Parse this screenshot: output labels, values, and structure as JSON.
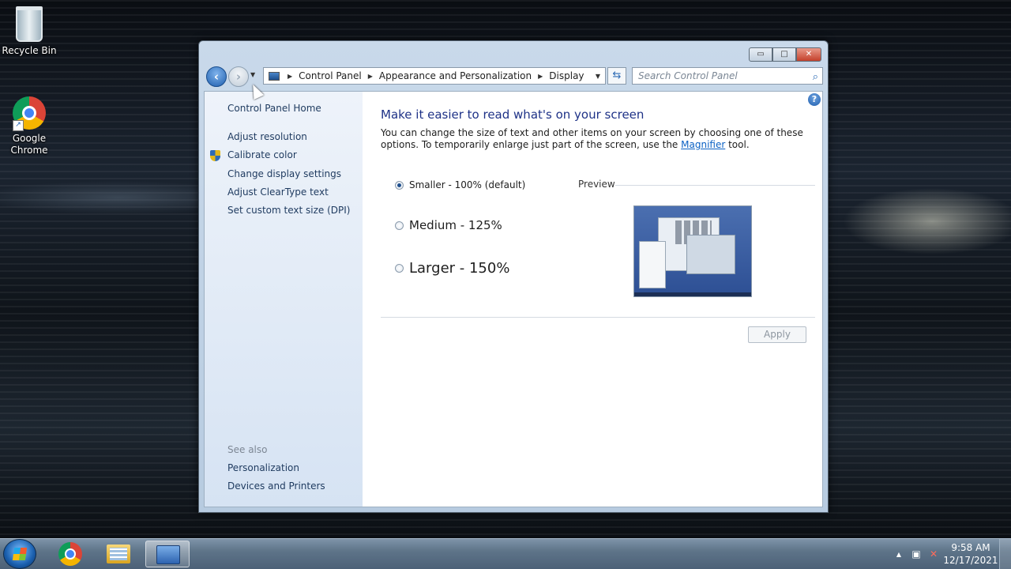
{
  "desktop": {
    "icons": [
      {
        "label": "Recycle Bin"
      },
      {
        "label": "Google\nChrome"
      }
    ]
  },
  "window": {
    "controls": {
      "minimize": "▭",
      "maximize": "□",
      "close": "✕"
    },
    "nav": {
      "back": "‹",
      "forward": "›",
      "dropdown": "▼"
    },
    "address": {
      "crumbs": [
        "Control Panel",
        "Appearance and Personalization",
        "Display"
      ],
      "separator": "▶",
      "dropdown": "▼"
    },
    "refresh_symbol": "⇆",
    "search": {
      "placeholder": "Search Control Panel",
      "icon": "⌕"
    }
  },
  "sidebar": {
    "home": "Control Panel Home",
    "links": [
      "Adjust resolution",
      "Calibrate color",
      "Change display settings",
      "Adjust ClearType text",
      "Set custom text size (DPI)"
    ],
    "see_also_label": "See also",
    "see_also": [
      "Personalization",
      "Devices and Printers"
    ]
  },
  "main": {
    "help": "?",
    "heading": "Make it easier to read what's on your screen",
    "description_before": "You can change the size of text and other items on your screen by choosing one of these options. To temporarily enlarge just part of the screen, use the ",
    "magnifier_link": "Magnifier",
    "description_after": " tool.",
    "options": [
      {
        "label": "Smaller - 100% (default)",
        "checked": true
      },
      {
        "label": "Medium - 125%",
        "checked": false
      },
      {
        "label": "Larger - 150%",
        "checked": false
      }
    ],
    "preview_label": "Preview",
    "apply": "Apply"
  },
  "taskbar": {
    "tray": {
      "up_arrow": "▲",
      "network": "▣",
      "volume": "✕"
    },
    "clock": {
      "time": "9:58 AM",
      "date": "12/17/2021"
    }
  }
}
